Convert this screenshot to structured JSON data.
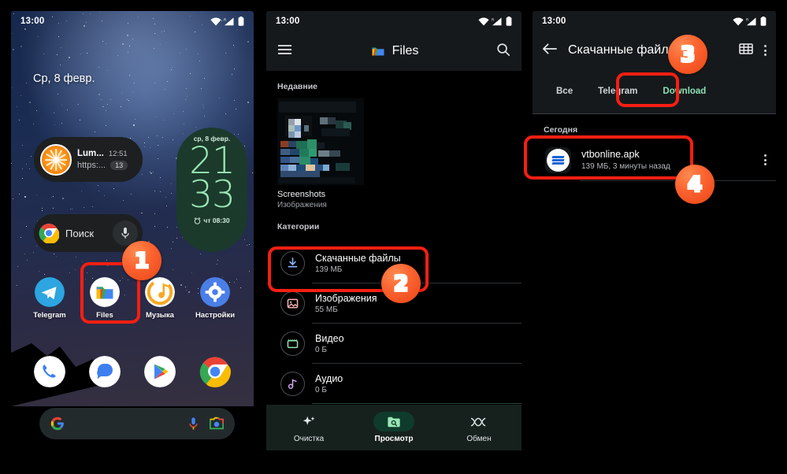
{
  "left_phone": {
    "status": {
      "time": "13:00",
      "icons": [
        "wifi-icon",
        "signal-roaming-icon",
        "battery-icon"
      ]
    },
    "date_label": "Ср, 8 февр.",
    "notification": {
      "app_icon": "orange-slice-icon",
      "title": "Lum...",
      "time": "12:51",
      "subtitle": "https:...",
      "badge_count": "13"
    },
    "clock_widget": {
      "date": "ср, 8 февр.",
      "hours": "21",
      "minutes": "33",
      "alarm_icon": "alarm-clock-icon",
      "alarm": "чт 08:30"
    },
    "chrome_pill": {
      "icon": "chrome-icon",
      "label": "Поиск",
      "mic_icon": "microphone-icon"
    },
    "apps": [
      {
        "name": "Telegram",
        "icon": "telegram-icon"
      },
      {
        "name": "Files",
        "icon": "files-icon"
      },
      {
        "name": "Музыка",
        "icon": "music-icon"
      },
      {
        "name": "Настройки",
        "icon": "settings-gear-icon"
      }
    ],
    "dock": [
      {
        "name": "phone",
        "icon": "phone-icon"
      },
      {
        "name": "messages",
        "icon": "messages-icon"
      },
      {
        "name": "play-store",
        "icon": "play-store-icon"
      },
      {
        "name": "chrome",
        "icon": "chrome-icon"
      }
    ],
    "google_search_bar": {
      "logo": "google-g-icon",
      "mic_icon": "microphone-icon",
      "lens_icon": "google-lens-icon"
    }
  },
  "mid_phone": {
    "status": {
      "time": "13:00"
    },
    "appbar": {
      "menu_icon": "hamburger-menu-icon",
      "logo": "files-icon",
      "title": "Files",
      "search_icon": "search-icon"
    },
    "recent_section": "Недавние",
    "recent_card": {
      "name": "Screenshots",
      "subtitle": "Изображения"
    },
    "categories_section": "Категории",
    "categories": [
      {
        "label": "Скачанные файлы",
        "size": "139 МБ",
        "icon": "download-icon",
        "color": "#8ab4f8"
      },
      {
        "label": "Изображения",
        "size": "55 МБ",
        "icon": "image-icon",
        "color": "#f8b4b4"
      },
      {
        "label": "Видео",
        "size": "0 Б",
        "icon": "video-icon",
        "color": "#8ee4b0"
      },
      {
        "label": "Аудио",
        "size": "0 Б",
        "icon": "audio-note-icon",
        "color": "#d4a5f5"
      }
    ],
    "bottom_nav": [
      {
        "label": "Очистка",
        "icon": "sparkle-clean-icon",
        "active": false
      },
      {
        "label": "Просмотр",
        "icon": "browse-folder-icon",
        "active": true
      },
      {
        "label": "Обмен",
        "icon": "share-nearby-icon",
        "active": false
      }
    ]
  },
  "right_phone": {
    "status": {
      "time": "13:00"
    },
    "appbar": {
      "back_icon": "back-arrow-icon",
      "title": "Скачанные файлы",
      "grid_icon": "grid-view-icon",
      "overflow_icon": "more-vertical-icon"
    },
    "tabs": [
      {
        "label": "Все",
        "active": false
      },
      {
        "label": "Telegram",
        "active": false
      },
      {
        "label": "Download",
        "active": true
      }
    ],
    "section": "Сегодня",
    "files": [
      {
        "name": "vtbonline.apk",
        "meta": "139 МБ, 3 минуты назад",
        "icon": "apk-vtb-icon",
        "overflow_icon": "more-vertical-icon"
      }
    ]
  },
  "annotations": {
    "accent_red": "#f61f12",
    "accent_orange": "#fb6330",
    "badges": [
      {
        "number": "1"
      },
      {
        "number": "2"
      },
      {
        "number": "3"
      },
      {
        "number": "4"
      }
    ]
  }
}
